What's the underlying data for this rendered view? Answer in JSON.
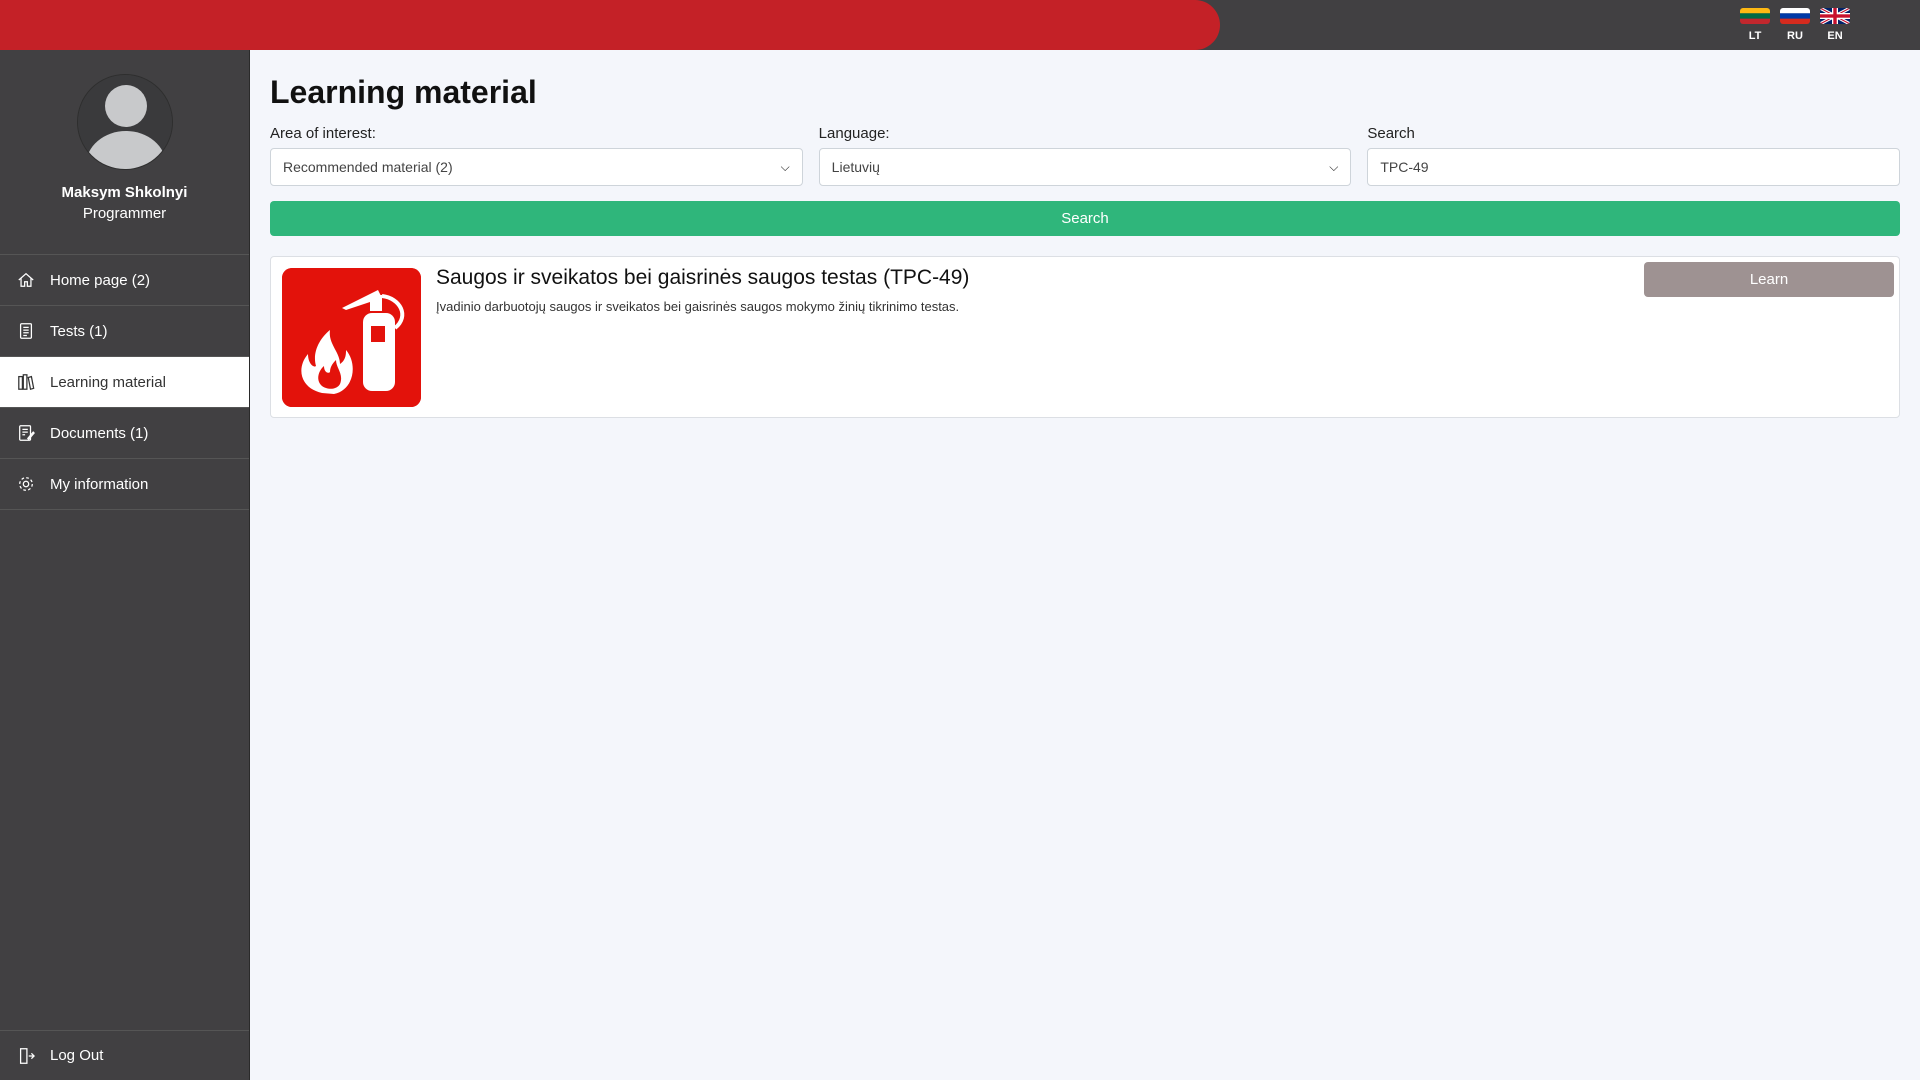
{
  "languages": [
    {
      "code": "LT",
      "icon": "flag-lithuania-icon"
    },
    {
      "code": "RU",
      "icon": "flag-russia-icon"
    },
    {
      "code": "EN",
      "icon": "flag-uk-icon"
    }
  ],
  "profile": {
    "name": "Maksym Shkolnyi",
    "role": "Programmer",
    "avatar_icon": "user-placeholder-icon"
  },
  "nav": {
    "items": [
      {
        "label": "Home page (2)",
        "icon": "home-icon"
      },
      {
        "label": "Tests (1)",
        "icon": "tests-icon"
      },
      {
        "label": "Learning material",
        "icon": "books-icon",
        "active": true
      },
      {
        "label": "Documents (1)",
        "icon": "documents-icon"
      },
      {
        "label": "My information",
        "icon": "gear-icon"
      }
    ],
    "logout_label": "Log Out"
  },
  "page": {
    "title": "Learning material",
    "filters": {
      "area_label": "Area of interest:",
      "area_value": "Recommended material (2)",
      "language_label": "Language:",
      "language_value": "Lietuvių",
      "search_label": "Search",
      "search_value": "TPC-49"
    },
    "search_button": "Search"
  },
  "results": [
    {
      "title": "Saugos ir sveikatos bei gaisrinės saugos testas (TPC-49)",
      "description": "Įvadinio darbuotojų saugos ir sveikatos bei gaisrinės saugos mokymo žinių tikrinimo testas.",
      "action_label": "Learn",
      "thumbnail_icon": "fire-extinguisher-icon"
    }
  ],
  "colors": {
    "topbar_red": "#c42127",
    "dark": "#414042",
    "search_green": "#2fb67b",
    "learn_gray": "#9e9292",
    "thumb_red": "#e3120b"
  }
}
